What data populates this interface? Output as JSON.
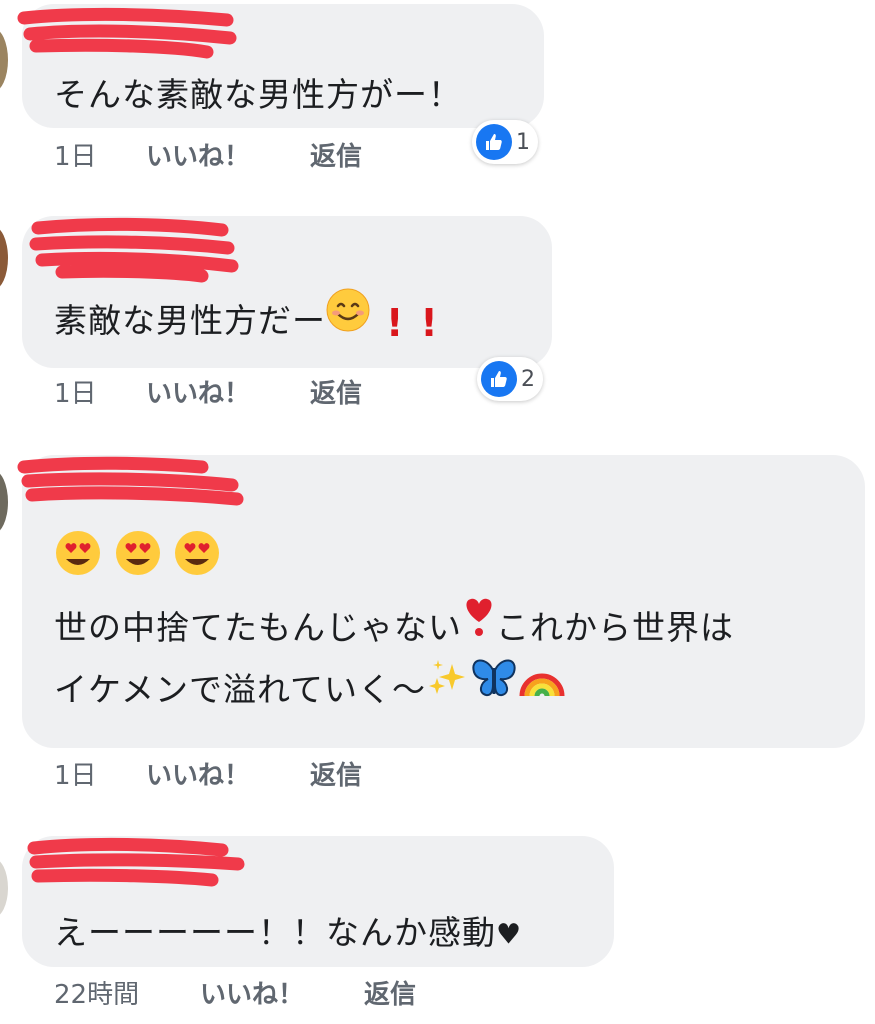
{
  "comments": [
    {
      "text": "そんな素敵な男性方がー！",
      "time": "1日",
      "like_label": "いいね！",
      "reply_label": "返信",
      "reaction_count": "1"
    },
    {
      "text": "素敵な男性方だー",
      "emojis": [
        "smiling-face-icon",
        "exclamation-icon",
        "exclamation-icon"
      ],
      "time": "1日",
      "like_label": "いいね！",
      "reply_label": "返信",
      "reaction_count": "2"
    },
    {
      "lines": [
        "",
        "世の中捨てたもんじゃない",
        "これから世界は",
        "イケメンで溢れていく〜"
      ],
      "emojis_line1": [
        "heart-eyes-icon",
        "heart-eyes-icon",
        "heart-eyes-icon"
      ],
      "emojis_mid": [
        "red-heart-exclamation-icon"
      ],
      "emojis_end": [
        "sparkles-icon",
        "butterfly-icon",
        "rainbow-icon"
      ],
      "time": "1日",
      "like_label": "いいね！",
      "reply_label": "返信"
    },
    {
      "text": "えーーーーー！！なんか感動",
      "heart": "♥",
      "time": "22時間",
      "like_label": "いいね！",
      "reply_label": "返信"
    }
  ],
  "colors": {
    "bubble": "#eff0f2",
    "text": "#1c1e21",
    "meta": "#606770",
    "like_blue": "#1877f2",
    "redaction": "#f03a4a"
  }
}
